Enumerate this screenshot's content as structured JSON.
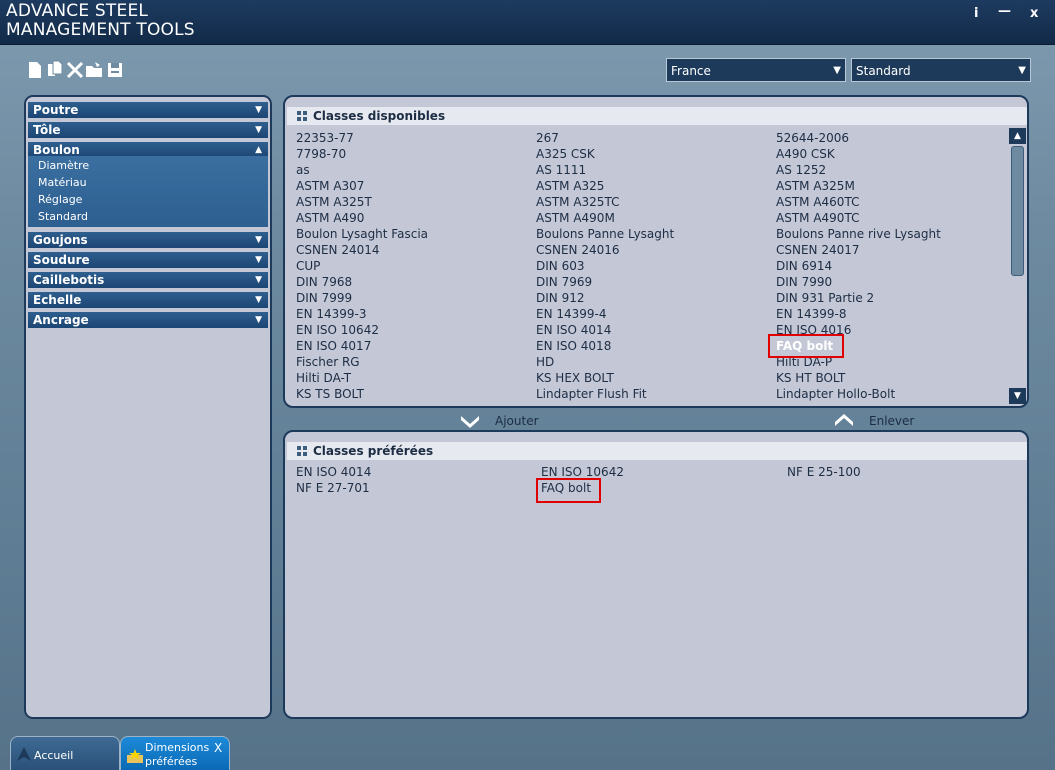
{
  "app": {
    "title_line1": "ADVANCE STEEL",
    "title_line2": "MANAGEMENT TOOLS",
    "window_buttons": [
      "i",
      "—",
      "x"
    ]
  },
  "toolbar": {
    "icons": [
      "new-file-icon",
      "copy-icon",
      "delete-icon",
      "open-folder-icon",
      "save-icon"
    ]
  },
  "selects": {
    "country": "France",
    "standard": "Standard"
  },
  "sidebar": {
    "categories": [
      {
        "label": "Poutre",
        "expanded": false
      },
      {
        "label": "Tôle",
        "expanded": false
      },
      {
        "label": "Boulon",
        "expanded": true
      },
      {
        "label": "Goujons",
        "expanded": false
      },
      {
        "label": "Soudure",
        "expanded": false
      },
      {
        "label": "Caillebotis",
        "expanded": false
      },
      {
        "label": "Echelle",
        "expanded": false
      },
      {
        "label": "Ancrage",
        "expanded": false
      }
    ],
    "boulon_sub": [
      "Diamètre",
      "Matériau",
      "Réglage",
      "Standard"
    ]
  },
  "available": {
    "title": "Classes disponibles",
    "col1": [
      "22353-77",
      "7798-70",
      "as",
      "ASTM A307",
      "ASTM A325T",
      "ASTM A490",
      "Boulon Lysaght Fascia",
      "CSNEN 24014",
      "CUP",
      "DIN 7968",
      "DIN 7999",
      "EN 14399-3",
      "EN ISO 10642",
      "EN ISO 4017",
      "Fischer RG",
      "Hilti DA-T",
      "KS TS BOLT"
    ],
    "col2": [
      "267",
      "A325 CSK",
      "AS 1111",
      "ASTM A325",
      "ASTM A325TC",
      "ASTM A490M",
      "Boulons Panne Lysaght",
      "CSNEN 24016",
      "DIN 603",
      "DIN 7969",
      "DIN 912",
      "EN 14399-4",
      "EN ISO 4014",
      "EN ISO 4018",
      "HD",
      "KS HEX BOLT",
      "Lindapter Flush Fit"
    ],
    "col3": [
      "52644-2006",
      "A490 CSK",
      "AS 1252",
      "ASTM A325M",
      "ASTM A460TC",
      "ASTM A490TC",
      "Boulons Panne rive Lysaght",
      "CSNEN 24017",
      "DIN 6914",
      "DIN 7990",
      "DIN 931 Partie 2",
      "EN 14399-8",
      "EN ISO 4016",
      "FAQ bolt",
      "Hilti DA-P",
      "KS HT BOLT",
      "Lindapter Hollo-Bolt"
    ],
    "selected": "FAQ bolt"
  },
  "actions": {
    "add": "Ajouter",
    "remove": "Enlever"
  },
  "preferred": {
    "title": "Classes préférées",
    "col1": [
      "EN ISO 4014",
      "NF E 27-701"
    ],
    "col2": [
      "EN ISO 10642",
      "FAQ bolt"
    ],
    "col3": [
      "NF E 25-100"
    ]
  },
  "tabs": {
    "home": "Accueil",
    "active_line1": "Dimensions",
    "active_line2": "préférées",
    "close": "X"
  }
}
